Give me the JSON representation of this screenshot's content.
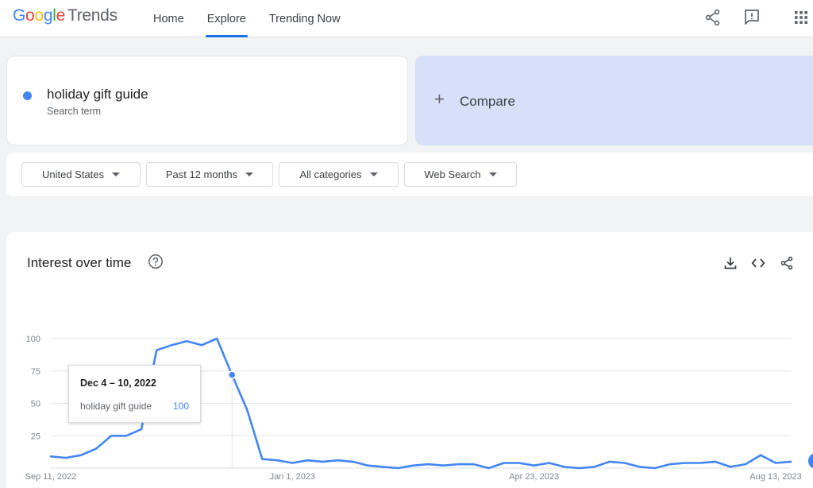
{
  "header": {
    "logo": {
      "google": [
        "G",
        "o",
        "o",
        "g",
        "l",
        "e"
      ],
      "trends": "Trends"
    },
    "nav": [
      {
        "label": "Home",
        "active": false
      },
      {
        "label": "Explore",
        "active": true
      },
      {
        "label": "Trending Now",
        "active": false
      }
    ],
    "icons": [
      "share-icon",
      "feedback-icon",
      "apps-icon"
    ]
  },
  "search": {
    "term": "holiday gift guide",
    "sublabel": "Search term",
    "color": "#4285f4"
  },
  "compare": {
    "plus": "+",
    "label": "Compare"
  },
  "filters": [
    {
      "label": "United States"
    },
    {
      "label": "Past 12 months"
    },
    {
      "label": "All categories"
    },
    {
      "label": "Web Search"
    }
  ],
  "chart_card": {
    "title": "Interest over time",
    "icons": [
      "help-icon",
      "download-icon",
      "embed-icon",
      "share-icon"
    ]
  },
  "tooltip": {
    "date": "Dec 4 – 10, 2022",
    "series": "holiday gift guide",
    "value": "100"
  },
  "chart_data": {
    "type": "line",
    "title": "Interest over time",
    "y_ticks": [
      25,
      50,
      75,
      100
    ],
    "ylim": [
      0,
      100
    ],
    "x_labels": [
      "Sep 11, 2022",
      "Jan 1, 2023",
      "Apr 23, 2023",
      "Aug 13, 2023"
    ],
    "x_label_weeks": [
      0,
      16,
      32,
      48
    ],
    "grid": true,
    "series": [
      {
        "name": "holiday gift guide",
        "color": "#4285f4",
        "values": [
          9,
          8,
          10,
          15,
          25,
          25,
          30,
          91,
          95,
          98,
          95,
          100,
          72,
          45,
          7,
          6,
          4,
          6,
          5,
          6,
          5,
          2,
          1,
          0,
          2,
          3,
          2,
          3,
          3,
          0,
          4,
          4,
          2,
          4,
          1,
          0,
          1,
          5,
          4,
          1,
          0,
          3,
          4,
          4,
          5,
          1,
          3,
          10,
          4,
          5
        ]
      }
    ],
    "highlight_index": 12
  }
}
